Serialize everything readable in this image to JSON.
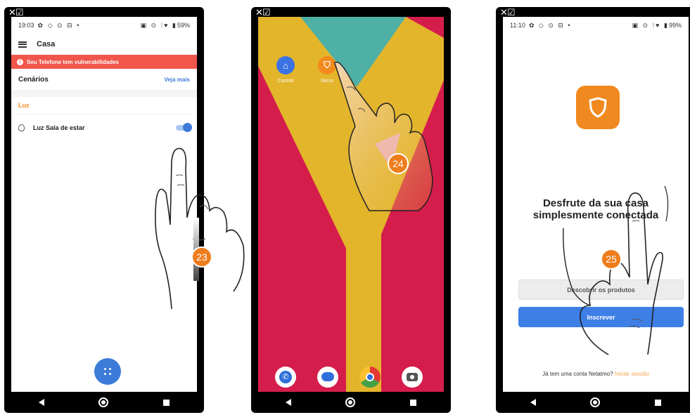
{
  "corner_mark": "✕☑",
  "phones": {
    "p1": {
      "time": "19:03",
      "status_left_icons": "✿ ◇ ⊙ ⊟ •",
      "status_right_icons": "▣ ⊙ ⁞♥ ▮",
      "battery": "59%",
      "title": "Casa",
      "alert_text": "Seu Telefone tem vulnerabilidades",
      "scenes_label": "Cenários",
      "see_more": "Veja mais",
      "category": "Luz",
      "light_item": "Luz Sala de estar",
      "light_on": true,
      "step": "23"
    },
    "p2": {
      "apps": [
        "Control",
        "Secur"
      ],
      "dock": [
        "phone",
        "messages",
        "chrome",
        "camera"
      ],
      "step": "24"
    },
    "p3": {
      "time": "11:10",
      "status_left_icons": "✿ ◇ ⊙ ⊟ •",
      "status_right_icons": "▣ ⊙ ⁞♥ ▮",
      "battery": "99%",
      "headline_1": "Desfrute da sua casa",
      "headline_2": "simplesmente conectada",
      "discover_button": "Descobrir os produtos",
      "signup_button": "Inscrever",
      "login_prompt": "Já tem uma conta Netatmo?",
      "login_link": "Iniciar sessão",
      "step": "25"
    }
  },
  "colors": {
    "accent_orange": "#ee7d1c",
    "accent_blue": "#3d7bd9",
    "alert_red": "#f0564a",
    "wall_teal": "#4fb0a6",
    "wall_yellow": "#e3b52b",
    "wall_crimson": "#d51d4b"
  }
}
